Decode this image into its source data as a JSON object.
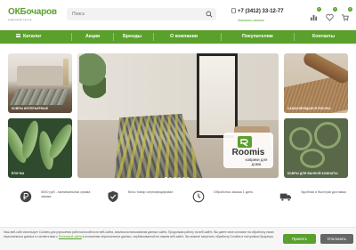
{
  "header": {
    "logo_ok": "ОК",
    "logo_name": "Бочаров",
    "logo_tagline": "ковровый салон",
    "search_placeholder": "Поиск",
    "phone": "+7 (3412) 33-12-77",
    "callback": "Заказать звонок",
    "compare_count": "0",
    "favorites_count": "0",
    "cart_count": "0"
  },
  "nav": {
    "items": [
      "Каталог",
      "Акции",
      "Бренды",
      "О компании",
      "Покупателям",
      "Контакты"
    ]
  },
  "tiles": {
    "interior": "Ковры интерьерные",
    "kids": "Ёлочка",
    "rolls": "Самоклеящаяся ёлочка",
    "bathroom": "Ковры для ванной комнаты"
  },
  "hero": {
    "brand": "Roomis",
    "subtitle": "коврики для дома",
    "slides": 6,
    "active_slide": 1
  },
  "features": [
    {
      "icon": "ruble-icon",
      "text": "5000 руб - минимальная сумма заказа"
    },
    {
      "icon": "shield-check-icon",
      "text": "Весь товар сертифицирован"
    },
    {
      "icon": "clock-icon",
      "text": "Обработка заказа 1 день"
    },
    {
      "icon": "delivery-icon",
      "text": "Удобная и быстрая доставка"
    }
  ],
  "cookie": {
    "text_before": "Наш веб-сайт использует Cookies для улучшения работоспособности веб-сайта, анализа использования данных сайта. Продолжая работу на веб-сайте, Вы даете свое согласие на обработку своих персональных данных в соответствии с ",
    "link": "Политикой сайта",
    "text_after": " в отношении персональных данных, опубликованной на нашем веб-сайте. Вы можете запретить обработку Cookies в настройках браузера.",
    "accept": "Принять",
    "decline": "Отклонить"
  },
  "colors": {
    "brand_green": "#5aa02c",
    "decline_gray": "#666666"
  }
}
